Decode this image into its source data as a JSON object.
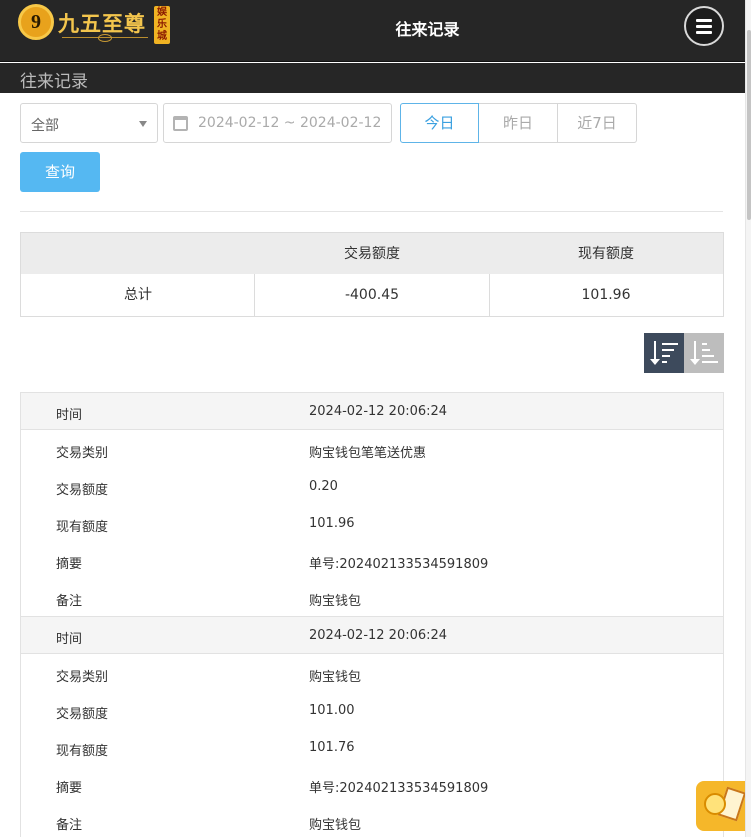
{
  "header": {
    "logo_text": "九五至尊",
    "logo_badge": "娱乐城",
    "logo_mark": "9",
    "title": "往来记录"
  },
  "subheader": {
    "title": "往来记录"
  },
  "filters": {
    "type_selected": "全部",
    "date_range": "2024-02-12 ~ 2024-02-12",
    "quick_ranges": [
      "今日",
      "昨日",
      "近7日"
    ],
    "active_range": "今日",
    "query_label": "查询"
  },
  "summary": {
    "col_amount": "交易额度",
    "col_balance": "现有额度",
    "row_label": "总计",
    "total_amount": "-400.45",
    "total_balance": "101.96"
  },
  "records": [
    {
      "fields": [
        {
          "label": "时间",
          "value": "2024-02-12 20:06:24"
        },
        {
          "label": "交易类别",
          "value": "购宝钱包笔笔送优惠"
        },
        {
          "label": "交易额度",
          "value": "0.20"
        },
        {
          "label": "现有额度",
          "value": "101.96"
        },
        {
          "label": "摘要",
          "value": "单号:202402133534591809"
        },
        {
          "label": "备注",
          "value": "购宝钱包"
        }
      ]
    },
    {
      "fields": [
        {
          "label": "时间",
          "value": "2024-02-12 20:06:24"
        },
        {
          "label": "交易类别",
          "value": "购宝钱包"
        },
        {
          "label": "交易额度",
          "value": "101.00"
        },
        {
          "label": "现有额度",
          "value": "101.76"
        },
        {
          "label": "摘要",
          "value": "单号:202402133534591809"
        },
        {
          "label": "备注",
          "value": "购宝钱包"
        }
      ]
    }
  ],
  "icons": {
    "menu": "hamburger-menu-icon",
    "calendar": "calendar-icon",
    "sort_desc": "sort-descending-icon",
    "sort_asc": "sort-ascending-icon",
    "float": "coupon-icon"
  },
  "colors": {
    "header_bg": "#262626",
    "accent": "#55b8f2",
    "sort_active": "#3d4a5c",
    "logo_gold": "#f3c54d"
  }
}
